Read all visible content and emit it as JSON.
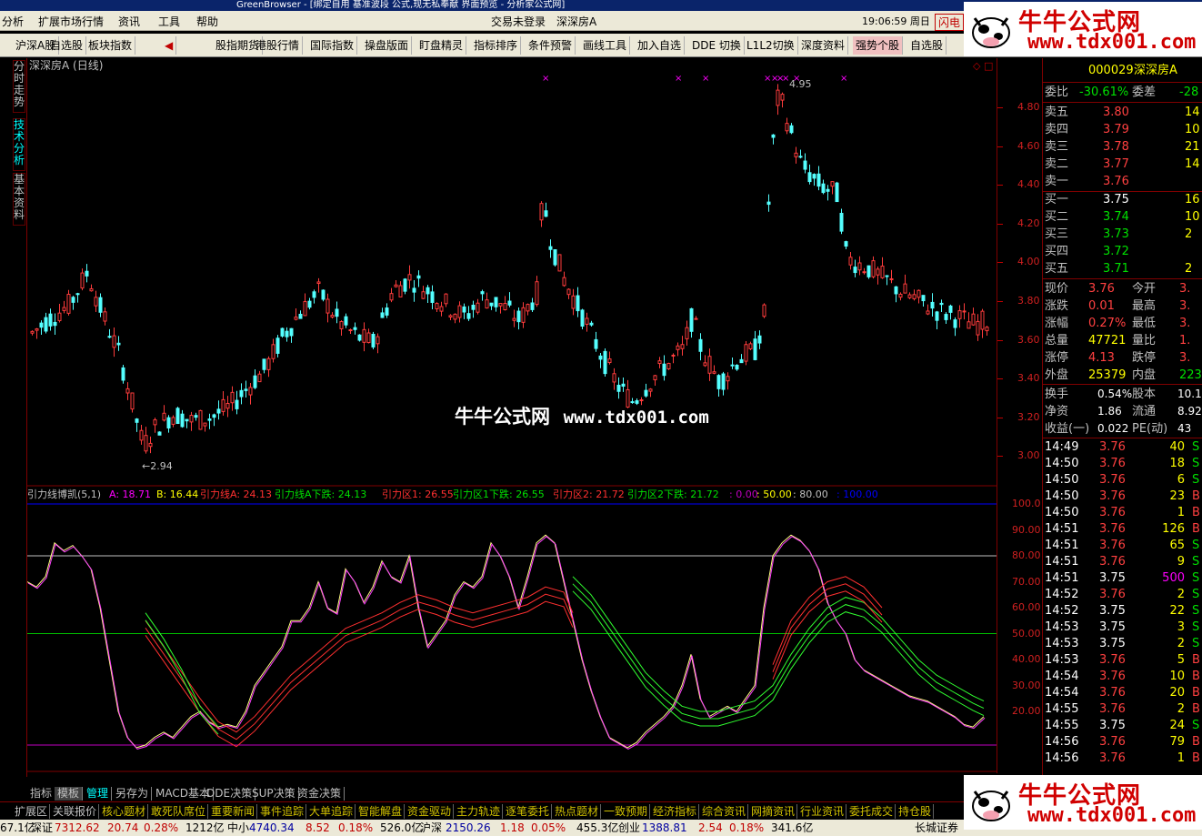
{
  "titlebar": {
    "text": "GreenBrowser - [绑定自用 基准波段 公式,现无私奉献 界面预览 - 分析家公式网]"
  },
  "menu": {
    "items": [
      "分析",
      "扩展市场行情",
      "资讯",
      "工具",
      "帮助"
    ],
    "login": "交易未登录",
    "stock": "深深房A",
    "time": "19:06:59 周日",
    "right_btn": "闪电"
  },
  "toolbar": {
    "items": [
      "沪深A股",
      "自选股",
      "板块指数",
      "◀",
      "股指期货",
      "港股行情",
      "国际指数",
      "操盘版面",
      "盯盘精灵",
      "指标排序",
      "条件预警",
      "画线工具",
      "加入自选",
      "DDE 切换",
      "L1L2切换",
      "深度资料",
      "强势个股",
      "自选股"
    ]
  },
  "lefttabs": [
    "分时走势",
    "技术分析",
    "基本资料"
  ],
  "chart": {
    "title": "深深房A (日线)",
    "price_ticks": [
      "4.80",
      "4.60",
      "4.40",
      "4.20",
      "4.00",
      "3.80",
      "3.60",
      "3.40",
      "3.20",
      "3.00"
    ],
    "high_label": "4.95",
    "low_label": "2.94",
    "indicator_header": {
      "name": "引力线博凯(5,1)",
      "a": "A: 18.71",
      "b": "B: 16.44",
      "l1": "引力线A: 24.13",
      "l2": "引力线A下跌: 24.13",
      "l3": "引力区1: 26.55",
      "l4": "引力区1下跌: 26.55",
      "l5": "引力区2: 21.72",
      "l6": "引力区2下跌: 21.72",
      "l7": ": 0.00",
      "l8": ": 50.00",
      "l9": ": 80.00",
      "l10": ": 100.00"
    },
    "ind_ticks": [
      "100.0",
      "90.00",
      "80.00",
      "70.00",
      "60.00",
      "50.00",
      "40.00",
      "30.00",
      "20.00"
    ],
    "x_labels": [
      "2013年",
      "6",
      "7",
      "8",
      "9",
      "10",
      "11",
      "12",
      "1",
      "2",
      "3",
      "4",
      "5",
      "6"
    ]
  },
  "watermark": {
    "cn": "牛牛公式网",
    "url": "www.tdx001.com"
  },
  "logo": {
    "cn": "牛牛公式网",
    "url": "www.tdx001.com"
  },
  "quote": {
    "code": "000029",
    "name": "深深房A",
    "weibi": "-30.61%",
    "weicha": "-28",
    "asks": [
      {
        "label": "卖五",
        "price": "3.80",
        "vol": "14"
      },
      {
        "label": "卖四",
        "price": "3.79",
        "vol": "10"
      },
      {
        "label": "卖三",
        "price": "3.78",
        "vol": "21"
      },
      {
        "label": "卖二",
        "price": "3.77",
        "vol": "14"
      },
      {
        "label": "卖一",
        "price": "3.76",
        "vol": ""
      }
    ],
    "bids": [
      {
        "label": "买一",
        "price": "3.75",
        "vol": "16"
      },
      {
        "label": "买二",
        "price": "3.74",
        "vol": "10"
      },
      {
        "label": "买三",
        "price": "3.73",
        "vol": "2"
      },
      {
        "label": "买四",
        "price": "3.72",
        "vol": ""
      },
      {
        "label": "买五",
        "price": "3.71",
        "vol": "2"
      }
    ],
    "stats": [
      {
        "l1": "现价",
        "v1": "3.76",
        "l2": "今开",
        "v2": "3."
      },
      {
        "l1": "涨跌",
        "v1": "0.01",
        "l2": "最高",
        "v2": "3."
      },
      {
        "l1": "涨幅",
        "v1": "0.27%",
        "l2": "最低",
        "v2": "3."
      },
      {
        "l1": "总量",
        "v1": "47721",
        "l2": "量比",
        "v2": "1."
      },
      {
        "l1": "涨停",
        "v1": "4.13",
        "l2": "跌停",
        "v2": "3."
      },
      {
        "l1": "外盘",
        "v1": "25379",
        "l2": "内盘",
        "v2": "223"
      }
    ],
    "stats2": [
      {
        "l1": "换手",
        "v1": "0.54%",
        "l2": "股本",
        "v2": "10.1"
      },
      {
        "l1": "净资",
        "v1": "1.86",
        "l2": "流通",
        "v2": "8.92"
      },
      {
        "l1": "收益(一)",
        "v1": "0.022",
        "l2": "PE(动)",
        "v2": "43"
      }
    ],
    "ticks": [
      {
        "t": "14:49",
        "p": "3.76",
        "v": "40",
        "d": "S"
      },
      {
        "t": "14:50",
        "p": "3.76",
        "v": "18",
        "d": "S"
      },
      {
        "t": "14:50",
        "p": "3.76",
        "v": "6",
        "d": "S"
      },
      {
        "t": "14:50",
        "p": "3.76",
        "v": "23",
        "d": "B"
      },
      {
        "t": "14:50",
        "p": "3.76",
        "v": "1",
        "d": "B"
      },
      {
        "t": "14:51",
        "p": "3.76",
        "v": "126",
        "d": "B"
      },
      {
        "t": "14:51",
        "p": "3.76",
        "v": "65",
        "d": "S"
      },
      {
        "t": "14:51",
        "p": "3.76",
        "v": "9",
        "d": "S"
      },
      {
        "t": "14:51",
        "p": "3.75",
        "v": "500",
        "d": "S"
      },
      {
        "t": "14:52",
        "p": "3.76",
        "v": "2",
        "d": "S"
      },
      {
        "t": "14:52",
        "p": "3.75",
        "v": "22",
        "d": "S"
      },
      {
        "t": "14:53",
        "p": "3.75",
        "v": "3",
        "d": "S"
      },
      {
        "t": "14:53",
        "p": "3.75",
        "v": "2",
        "d": "S"
      },
      {
        "t": "14:53",
        "p": "3.76",
        "v": "5",
        "d": "B"
      },
      {
        "t": "14:54",
        "p": "3.76",
        "v": "10",
        "d": "B"
      },
      {
        "t": "14:54",
        "p": "3.76",
        "v": "20",
        "d": "B"
      },
      {
        "t": "14:55",
        "p": "3.76",
        "v": "2",
        "d": "B"
      },
      {
        "t": "14:55",
        "p": "3.75",
        "v": "24",
        "d": "S"
      },
      {
        "t": "14:56",
        "p": "3.76",
        "v": "79",
        "d": "B"
      },
      {
        "t": "14:56",
        "p": "3.76",
        "v": "1",
        "d": "B"
      }
    ]
  },
  "bottomtabs": [
    "指标",
    "模板",
    "管理",
    "另存为",
    "MACD基本",
    "DDE决策",
    "SUP决策",
    "资金决策"
  ],
  "funcbar": [
    "扩展区",
    "关联报价",
    "核心题材",
    "敢死队席位",
    "重要新闻",
    "事件追踪",
    "大单追踪",
    "智能解盘",
    "资金驱动",
    "主力轨迹",
    "逐笔委托",
    "热点题材",
    "一致预期",
    "经济指标",
    "综合资讯",
    "网摘资讯",
    "行业资讯",
    "委托成交",
    "持仓股"
  ],
  "status": {
    "s0": "67.1亿",
    "s1": "深证",
    "s2": "7312.62",
    "s3": "20.74",
    "s4": "0.28%",
    "s5": "1212亿",
    "s6": "中小",
    "s7": "4740.34",
    "s8": "8.52",
    "s9": "0.18%",
    "s10": "526.0亿",
    "s11": "沪深",
    "s12": "2150.26",
    "s13": "1.18",
    "s14": "0.05%",
    "s15": "455.3亿",
    "s16": "创业",
    "s17": "1388.81",
    "s18": "2.54",
    "s19": "0.18%",
    "s20": "341.6亿",
    "s21": "长城证券"
  }
}
